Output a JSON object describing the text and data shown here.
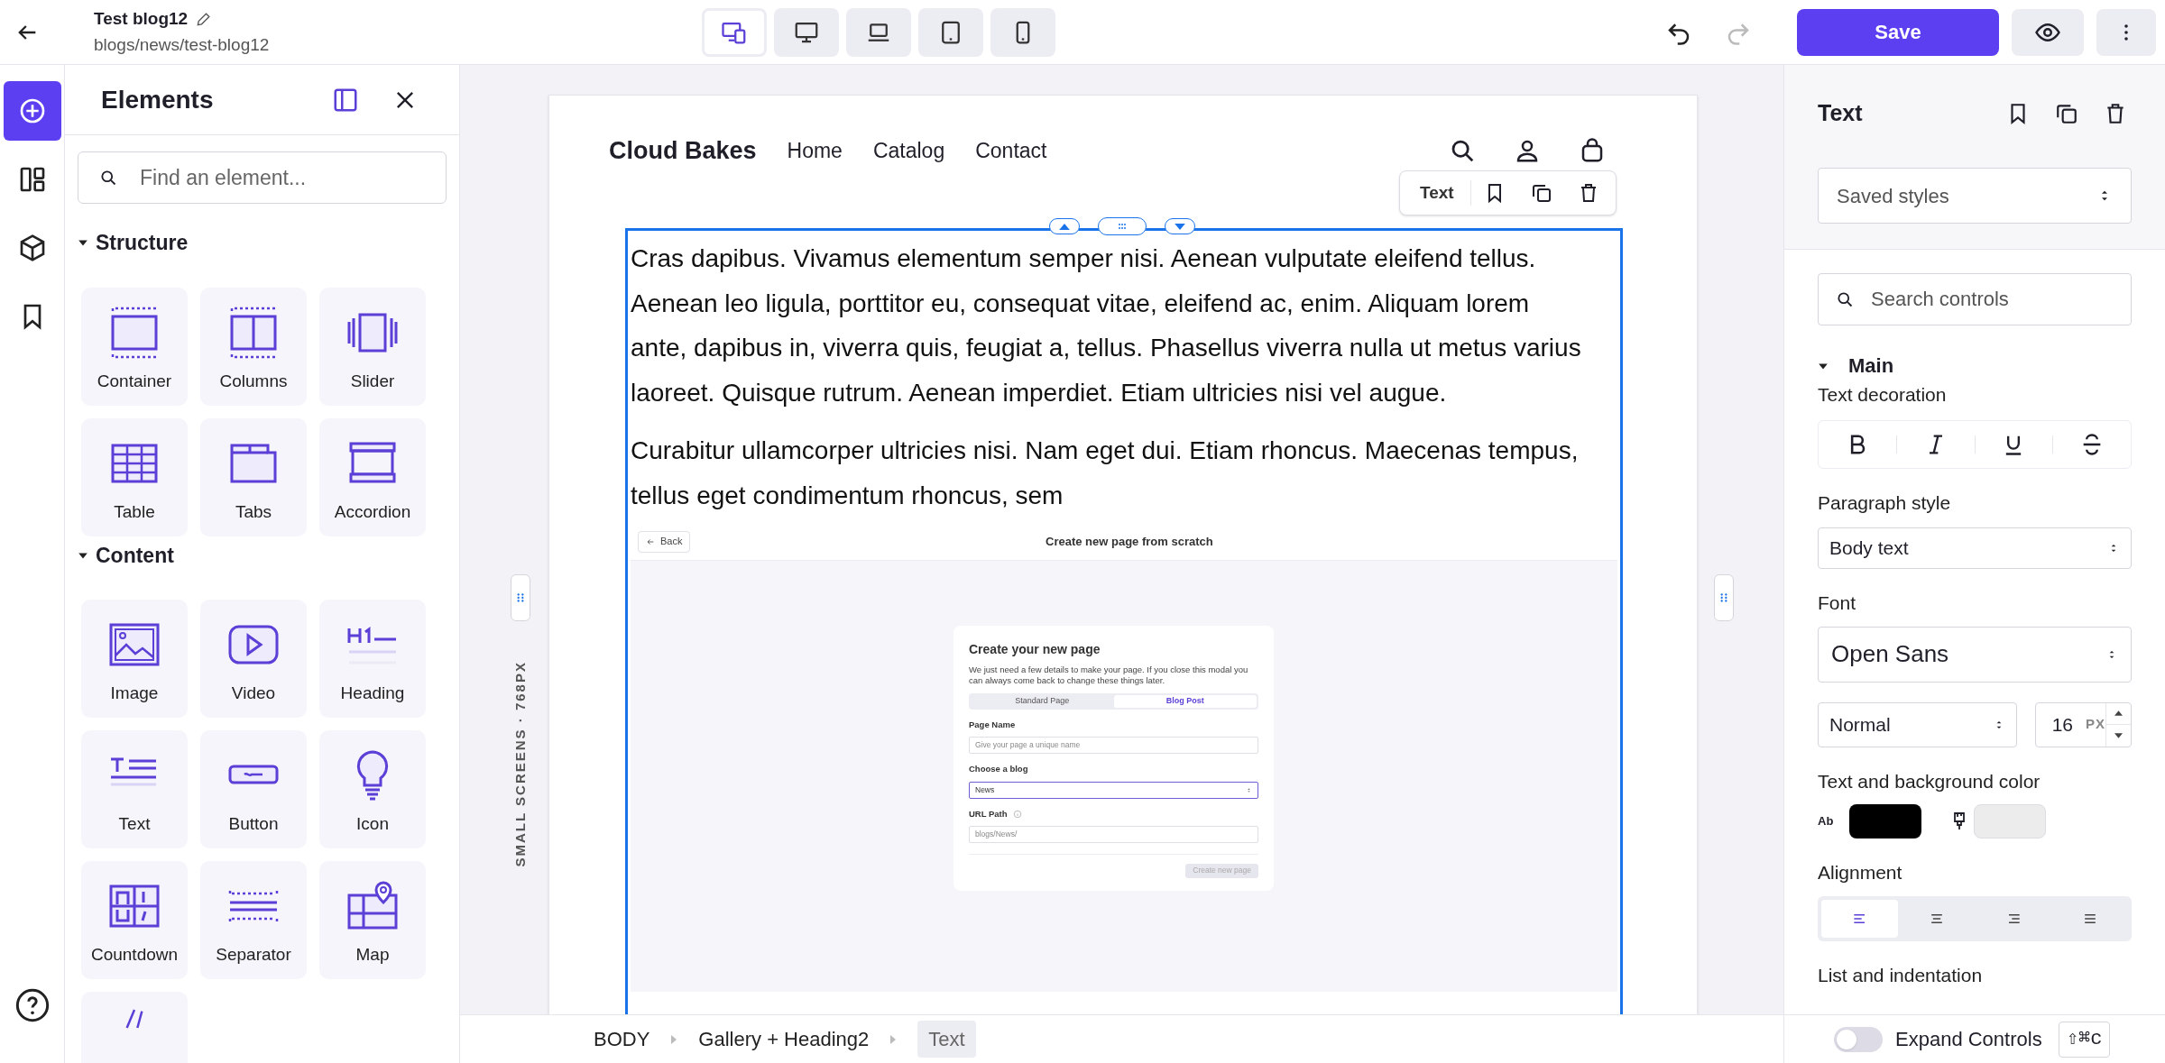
{
  "top_bar": {
    "title": "Test blog12",
    "path": "blogs/news/test-blog12",
    "devices": [
      {
        "selected": true
      },
      {
        "selected": false
      },
      {
        "selected": false
      },
      {
        "selected": false
      },
      {
        "selected": false
      }
    ],
    "undo": {
      "disabled": false
    },
    "redo": {
      "disabled": true
    },
    "save": "Save"
  },
  "rail": {
    "items": [
      {
        "selected": true
      },
      {
        "selected": false
      },
      {
        "selected": false
      },
      {
        "selected": false
      }
    ]
  },
  "elements_panel": {
    "title": "Elements",
    "search_placeholder": "Find an element...",
    "sections": [
      {
        "title": "Structure",
        "expanded": true,
        "items": [
          "Container",
          "Columns",
          "Slider",
          "Table",
          "Tabs",
          "Accordion"
        ]
      },
      {
        "title": "Content",
        "expanded": true,
        "items": [
          "Image",
          "Video",
          "Heading",
          "Text",
          "Button",
          "Icon",
          "Countdown",
          "Separator",
          "Map"
        ]
      }
    ]
  },
  "canvas": {
    "screen_label": "SMALL SCREENS · 768PX",
    "site": {
      "brand": "Cloud Bakes",
      "nav": [
        "Home",
        "Catalog",
        "Contact"
      ]
    },
    "element_toolbar": {
      "label": "Text"
    },
    "paragraphs": [
      "Cras dapibus. Vivamus elementum semper nisi. Aenean vulputate eleifend tellus. Aenean leo ligula, porttitor eu, consequat vitae, eleifend ac, enim. Aliquam lorem ante, dapibus in, viverra quis, feugiat a, tellus. Phasellus viverra nulla ut metus varius laoreet. Quisque rutrum. Aenean imperdiet. Etiam ultricies nisi vel augue.",
      "Curabitur ullamcorper ultricies nisi. Nam eget dui. Etiam rhoncus. Maecenas tempus, tellus eget condimentum rhoncus, sem"
    ],
    "embedded_screenshot": {
      "back": "Back",
      "title": "Create new page from scratch",
      "modal": {
        "title": "Create your new page",
        "description": "We just need a few details to make your page. If you close this modal you can always come back to change these things later.",
        "tabs": [
          {
            "label": "Standard Page",
            "selected": false
          },
          {
            "label": "Blog Post",
            "selected": true
          }
        ],
        "fields": [
          {
            "kind": "text",
            "label": "Page Name",
            "placeholder": "Give your page a unique name",
            "info": false,
            "focused": false
          },
          {
            "kind": "select",
            "label": "Choose a blog",
            "value": "News",
            "info": false,
            "focused": true
          },
          {
            "kind": "text",
            "label": "URL Path",
            "placeholder": "blogs/News/",
            "info": true,
            "focused": false
          }
        ],
        "button": {
          "label": "Create new page",
          "disabled": true
        }
      }
    }
  },
  "breadcrumb": [
    {
      "label": "BODY",
      "selected": false
    },
    {
      "label": "Gallery + Heading2",
      "selected": false
    },
    {
      "label": "Text",
      "selected": true
    }
  ],
  "properties": {
    "title": "Text",
    "saved_styles": "Saved styles",
    "search_placeholder": "Search controls",
    "section": {
      "title": "Main",
      "expanded": true
    },
    "text_decoration": {
      "label": "Text decoration"
    },
    "paragraph_style": {
      "label": "Paragraph style",
      "value": "Body text"
    },
    "font": {
      "label": "Font",
      "value": "Open Sans",
      "weight": "Normal",
      "size": "16",
      "unit": "PX"
    },
    "colors": {
      "label": "Text and background color",
      "text_swatch_label": "Ab"
    },
    "alignment": {
      "label": "Alignment",
      "options": [
        {
          "selected": true
        },
        {
          "selected": false
        },
        {
          "selected": false
        },
        {
          "selected": false
        }
      ]
    },
    "list_label": "List and indentation",
    "expand_controls": {
      "label": "Expand Controls",
      "on": false,
      "shortcut": "⇧⌘c"
    }
  }
}
